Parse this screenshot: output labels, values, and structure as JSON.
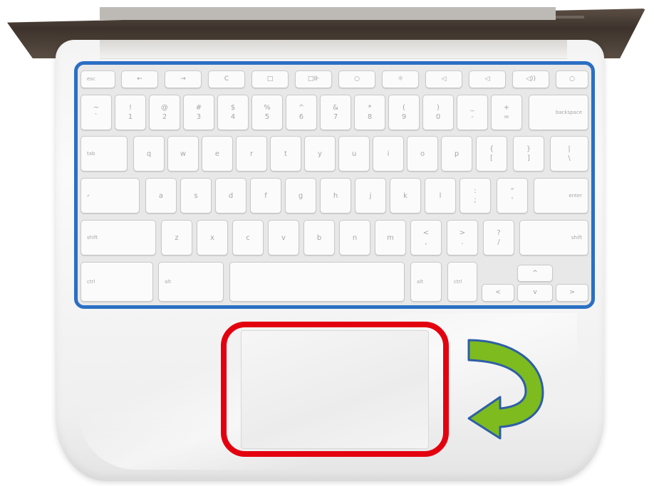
{
  "image": {
    "highlight_colors": {
      "keyboard_outline": "#2a6fc4",
      "touchpad_outline": "#e3000f",
      "arrow_fill": "#7dbb1f",
      "arrow_edge": "#2e5fa5"
    },
    "icons": {
      "arrow": "curved-arrow-icon"
    }
  },
  "keyboard": {
    "function_row": {
      "esc": "esc",
      "back": "←",
      "forward": "→",
      "reload": "C",
      "fullscreen": "□",
      "switch_window": "□⊪",
      "brightness_down": "○",
      "brightness_up": "☼",
      "mute": "◁",
      "volume_down": "◁",
      "volume_up": "◁))",
      "power": "○"
    },
    "number_row": [
      {
        "top": "~",
        "bottom": "`"
      },
      {
        "top": "!",
        "bottom": "1"
      },
      {
        "top": "@",
        "bottom": "2"
      },
      {
        "top": "#",
        "bottom": "3"
      },
      {
        "top": "$",
        "bottom": "4"
      },
      {
        "top": "%",
        "bottom": "5"
      },
      {
        "top": "^",
        "bottom": "6"
      },
      {
        "top": "&",
        "bottom": "7"
      },
      {
        "top": "*",
        "bottom": "8"
      },
      {
        "top": "(",
        "bottom": "9"
      },
      {
        "top": ")",
        "bottom": "0"
      },
      {
        "top": "_",
        "bottom": "-"
      },
      {
        "top": "+",
        "bottom": "="
      }
    ],
    "backspace": "backspace",
    "tab": "tab",
    "top_row": [
      "q",
      "w",
      "e",
      "r",
      "t",
      "y",
      "u",
      "i",
      "o",
      "p"
    ],
    "bracket_left": {
      "top": "{",
      "bottom": "["
    },
    "bracket_right": {
      "top": "}",
      "bottom": "]"
    },
    "backslash": {
      "top": "|",
      "bottom": "\\"
    },
    "search": "⌕",
    "home_row": [
      "a",
      "s",
      "d",
      "f",
      "g",
      "h",
      "j",
      "k",
      "l"
    ],
    "semicolon": {
      "top": ":",
      "bottom": ";"
    },
    "quote": {
      "top": "\"",
      "bottom": "'"
    },
    "enter": "enter",
    "shift_left": "shift",
    "bottom_letters": [
      "z",
      "x",
      "c",
      "v",
      "b",
      "n",
      "m"
    ],
    "comma": {
      "top": "<",
      "bottom": ","
    },
    "period": {
      "top": ">",
      "bottom": "."
    },
    "slash": {
      "top": "?",
      "bottom": "/"
    },
    "shift_right": "shift",
    "ctrl_left": "ctrl",
    "alt_left": "alt",
    "alt_right": "alt",
    "ctrl_right": "ctrl",
    "arrow_up": "^",
    "arrow_left": "<",
    "arrow_down": "v",
    "arrow_right": ">"
  }
}
